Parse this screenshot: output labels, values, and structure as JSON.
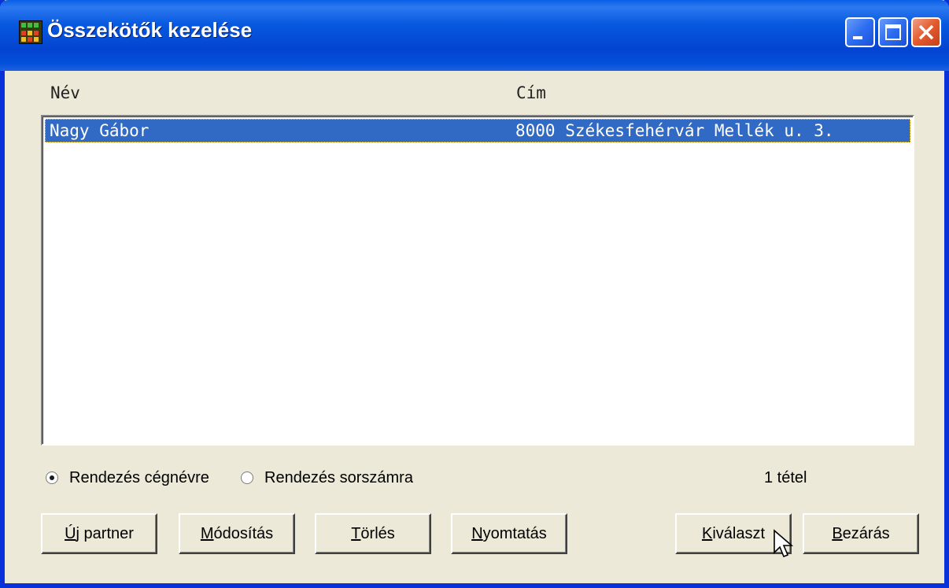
{
  "window": {
    "title": "Összekötők kezelése"
  },
  "list": {
    "columns": {
      "name": "Név",
      "address": "Cím"
    },
    "rows": [
      {
        "name": "Nagy Gábor",
        "address": "8000 Székesfehérvár Mellék u. 3."
      }
    ],
    "selected_row": 0
  },
  "sort": {
    "by_name_label": "Rendezés cégnévre",
    "by_number_label": "Rendezés sorszámra",
    "selected": "by_name"
  },
  "status": {
    "count_label": "1 tétel"
  },
  "buttons": {
    "new_partner": {
      "first": "Ú",
      "rest": "j partner"
    },
    "modify": {
      "first": "M",
      "rest": "ódosítás"
    },
    "delete": {
      "first": "T",
      "rest": "örlés"
    },
    "print": {
      "first": "N",
      "rest": "yomtatás"
    },
    "select": {
      "first": "K",
      "rest": "iválaszt"
    },
    "close": {
      "first": "B",
      "rest": "ezárás"
    }
  },
  "colors": {
    "selection": "#316ac5",
    "window_bg": "#ece9d8",
    "titlebar": "#0451dc"
  }
}
